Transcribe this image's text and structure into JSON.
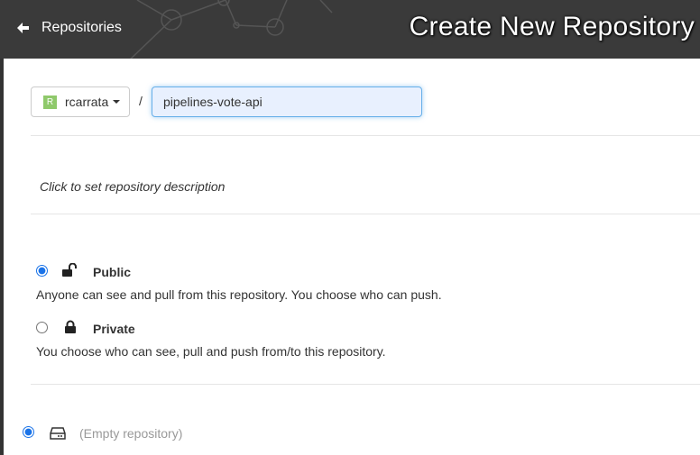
{
  "header": {
    "back_label": "Repositories",
    "title": "Create New Repository"
  },
  "namespace": {
    "avatar_letter": "R",
    "name": "rcarrata"
  },
  "separator": "/",
  "repository": {
    "name_value": "pipelines-vote-api"
  },
  "description": {
    "placeholder_text": "Click to set repository description"
  },
  "visibility": {
    "options": [
      {
        "label": "Public",
        "description": "Anyone can see and pull from this repository. You choose who can push.",
        "icon": "unlock-icon",
        "selected": true
      },
      {
        "label": "Private",
        "description": "You choose who can see, pull and push from/to this repository.",
        "icon": "lock-icon",
        "selected": false
      }
    ]
  },
  "initialize": {
    "empty_label": "(Empty repository)",
    "icon": "hard-drive-icon",
    "selected": true
  },
  "colors": {
    "header_bg": "#3a3a3a",
    "accent": "#1a73e8",
    "avatar": "#8fc96b"
  }
}
